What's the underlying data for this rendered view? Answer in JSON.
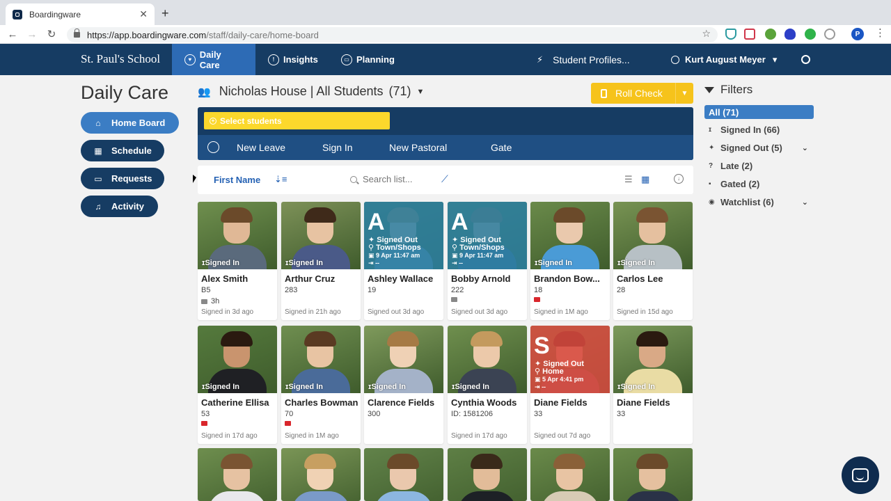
{
  "browser": {
    "tab_title": "Boardingware",
    "tab_close": "✕",
    "new_tab": "+",
    "url_host": "https://app.boardingware.com",
    "url_path": "/staff/daily-care/home-board",
    "profile_initial": "P",
    "extension_icons": [
      "shield-icon",
      "cross-icon",
      "robot-icon",
      "privacy-badger-icon",
      "evernote-icon",
      "refresh-icon"
    ]
  },
  "header": {
    "school": "St. Paul's School",
    "nav": [
      {
        "label": "Daily Care",
        "icon": "home-heart-icon",
        "active": true
      },
      {
        "label": "Insights",
        "icon": "lightbulb-icon",
        "active": false
      },
      {
        "label": "Planning",
        "icon": "calendar-icon",
        "active": false
      }
    ],
    "student_profiles": "Student Profiles...",
    "user": "Kurt August Meyer",
    "user_caret": "▾"
  },
  "sidebar": {
    "title": "Daily Care",
    "items": [
      {
        "label": "Home Board",
        "icon": "home-icon",
        "active": true
      },
      {
        "label": "Schedule",
        "icon": "calendar-icon",
        "active": false
      },
      {
        "label": "Requests",
        "icon": "inbox-icon",
        "active": false
      },
      {
        "label": "Activity",
        "icon": "bell-icon",
        "active": false
      }
    ]
  },
  "main": {
    "house": "Nicholas House | All Students",
    "count": "(71)",
    "roll_check": "Roll Check",
    "select_students": "Select students",
    "actions": [
      "New Leave",
      "Sign In",
      "New Pastoral",
      "Gate"
    ],
    "sort_label": "First Name",
    "search_placeholder": "Search list..."
  },
  "students": [
    {
      "name": "Alex Smith",
      "room": "B5",
      "badge": "3h",
      "badge_color": "#888888",
      "footer": "Signed in 3d ago",
      "status": "Signed In",
      "overlay": false
    },
    {
      "name": "Arthur Cruz",
      "room": "283",
      "badge": "",
      "badge_color": "",
      "footer": "Signed in 21h ago",
      "status": "Signed In",
      "overlay": false
    },
    {
      "name": "Ashley Wallace",
      "room": "19",
      "badge": "",
      "badge_color": "",
      "footer": "Signed out 3d ago",
      "status": "",
      "overlay": true,
      "overlay_letter": "A",
      "overlay_status": "Signed Out",
      "overlay_place": "Town/Shops",
      "overlay_time": "9 Apr 11:47 am",
      "overlay_return": "--",
      "overlay_color": "#2a7fa3"
    },
    {
      "name": "Bobby Arnold",
      "room": "222",
      "badge": "",
      "badge_color": "#888888",
      "footer": "Signed out 3d ago",
      "status": "",
      "overlay": true,
      "overlay_letter": "A",
      "overlay_status": "Signed Out",
      "overlay_place": "Town/Shops",
      "overlay_time": "9 Apr 11:47 am",
      "overlay_return": "--",
      "overlay_color": "#2a7fa3"
    },
    {
      "name": "Brandon Bow...",
      "room": "18",
      "badge": "",
      "badge_color": "#d9262c",
      "footer": "Signed in 1M ago",
      "status": "Signed In",
      "overlay": false
    },
    {
      "name": "Carlos Lee",
      "room": "28",
      "badge": "",
      "badge_color": "",
      "footer": "Signed in 15d ago",
      "status": "Signed In",
      "overlay": false
    },
    {
      "name": "Catherine Ellisa",
      "room": "53",
      "badge": "",
      "badge_color": "#d9262c",
      "footer": "Signed in 17d ago",
      "status": "Signed In",
      "overlay": false
    },
    {
      "name": "Charles Bowman",
      "room": "70",
      "badge": "",
      "badge_color": "#d9262c",
      "footer": "Signed in 1M ago",
      "status": "Signed In",
      "overlay": false
    },
    {
      "name": "Clarence Fields",
      "room": "300",
      "badge": "",
      "badge_color": "",
      "footer": "",
      "status": "Signed In",
      "overlay": false
    },
    {
      "name": "Cynthia Woods",
      "room": "ID: 1581206",
      "badge": "",
      "badge_color": "",
      "footer": "Signed in 17d ago",
      "status": "Signed In",
      "overlay": false
    },
    {
      "name": "Diane Fields",
      "room": "33",
      "badge": "",
      "badge_color": "",
      "footer": "Signed out 7d ago",
      "status": "",
      "overlay": true,
      "overlay_letter": "S",
      "overlay_status": "Signed Out",
      "overlay_place": "Home",
      "overlay_time": "5 Apr 4:41 pm",
      "overlay_return": "--",
      "overlay_color": "#d9493f"
    },
    {
      "name": "Diane Fields",
      "room": "33",
      "badge": "",
      "badge_color": "",
      "footer": "",
      "status": "Signed In",
      "overlay": false
    }
  ],
  "filters": {
    "title": "Filters",
    "items": [
      {
        "label": "All (71)",
        "icon": "",
        "active": true,
        "expand": false
      },
      {
        "label": "Signed In (66)",
        "icon": "standing-person-icon",
        "active": false,
        "expand": false
      },
      {
        "label": "Signed Out (5)",
        "icon": "walking-person-icon",
        "active": false,
        "expand": true
      },
      {
        "label": "Late (2)",
        "icon": "question-circle-icon",
        "active": false,
        "expand": false
      },
      {
        "label": "Gated (2)",
        "icon": "lock-icon",
        "active": false,
        "expand": false
      },
      {
        "label": "Watchlist (6)",
        "icon": "eye-icon",
        "active": false,
        "expand": true
      }
    ]
  },
  "colors": {
    "navy": "#163c63",
    "accent_blue": "#3b7dc4",
    "roll_check_yellow": "#f6c31b",
    "select_yellow": "#fcd82c"
  }
}
